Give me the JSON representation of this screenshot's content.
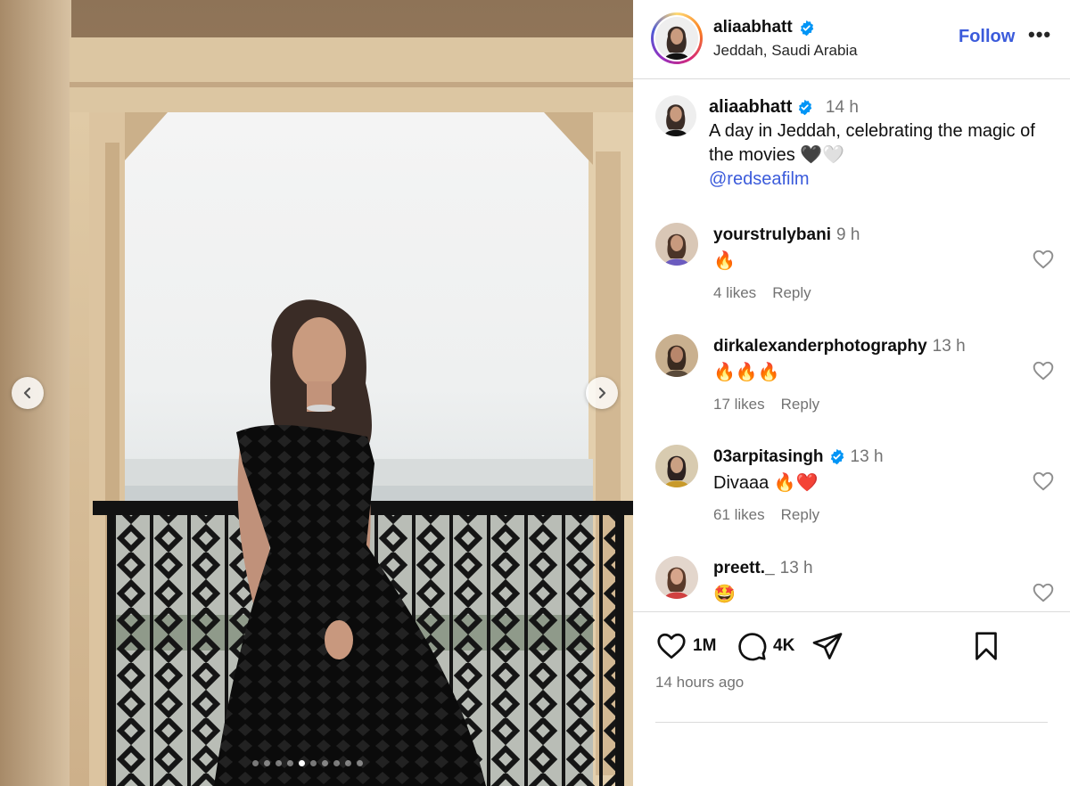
{
  "post": {
    "username": "aliaabhatt",
    "location": "Jeddah, Saudi Arabia",
    "follow_label": "Follow",
    "more_label": "•••",
    "verified_color": "#0095f6",
    "accent_color": "#3b5bdb"
  },
  "caption": {
    "username": "aliaabhatt",
    "time": "14 h",
    "text": "A day in Jeddah, celebrating the magic of the movies 🖤🤍",
    "mention": "@redseafilm"
  },
  "comments": [
    {
      "username": "yourstrulybani",
      "verified": false,
      "time": "9 h",
      "text": "🔥",
      "likes": "4 likes",
      "reply": "Reply"
    },
    {
      "username": "dirkalexanderphotography",
      "verified": false,
      "time": "13 h",
      "text": "🔥🔥🔥",
      "likes": "17 likes",
      "reply": "Reply"
    },
    {
      "username": "03arpitasingh",
      "verified": true,
      "time": "13 h",
      "text": "Divaaa 🔥❤️",
      "likes": "61 likes",
      "reply": "Reply"
    },
    {
      "username": "preett._",
      "verified": false,
      "time": "13 h",
      "text": "🤩",
      "likes": "",
      "reply": ""
    }
  ],
  "actions": {
    "like_count": "1M",
    "comment_count": "4K",
    "posted_ago": "14 hours ago"
  },
  "carousel": {
    "total_slides": 10,
    "active_slide": 5
  },
  "icons": {
    "like": "heart-icon",
    "comment": "comment-bubble-icon",
    "share": "paper-plane-icon",
    "save": "bookmark-icon",
    "prev": "chevron-left-icon",
    "next": "chevron-right-icon"
  }
}
